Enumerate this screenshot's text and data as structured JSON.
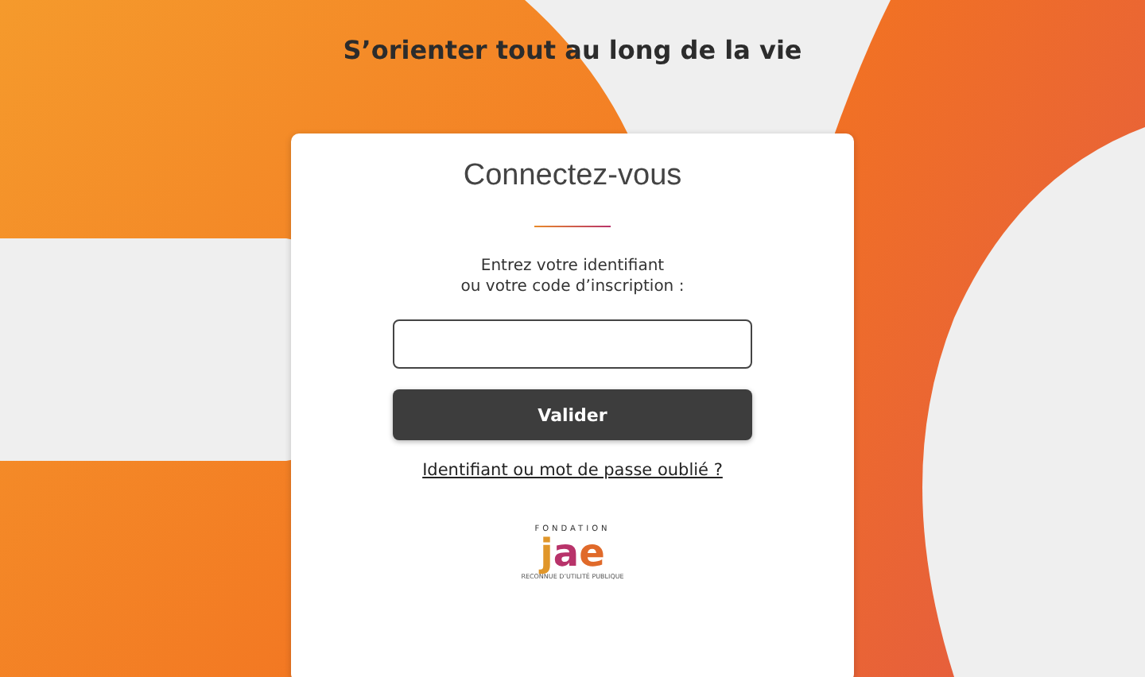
{
  "header": {
    "tagline": "S’orienter tout au long de la vie"
  },
  "login_card": {
    "title": "Connectez-vous",
    "prompt_line_1": "Entrez votre identifiant",
    "prompt_line_2": "ou votre code d’inscription :",
    "submit_button": "Valider",
    "forgot_link": "Identifiant ou mot de passe oublié ?"
  },
  "logo": {
    "top": "FONDATION",
    "mark_letters": [
      "j",
      "a",
      "e"
    ],
    "bottom": "RECONNUE D’UTILITÉ PUBLIQUE"
  }
}
